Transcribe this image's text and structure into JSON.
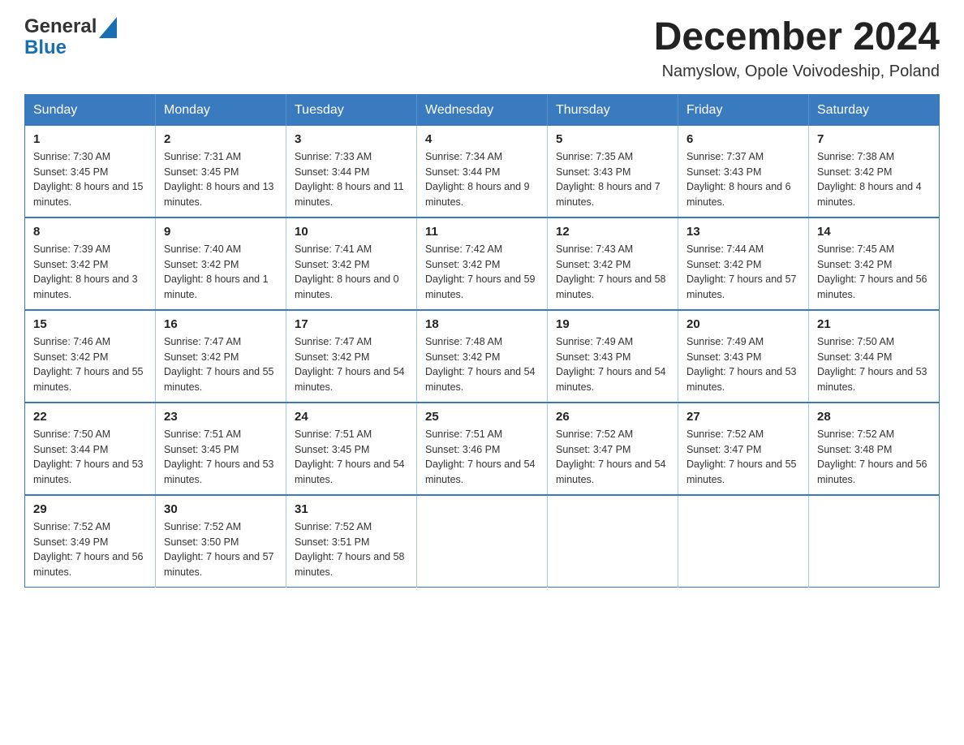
{
  "header": {
    "logo_general": "General",
    "logo_blue": "Blue",
    "month_year": "December 2024",
    "location": "Namyslow, Opole Voivodeship, Poland"
  },
  "days_of_week": [
    "Sunday",
    "Monday",
    "Tuesday",
    "Wednesday",
    "Thursday",
    "Friday",
    "Saturday"
  ],
  "weeks": [
    [
      {
        "day": "1",
        "sunrise": "7:30 AM",
        "sunset": "3:45 PM",
        "daylight": "8 hours and 15 minutes."
      },
      {
        "day": "2",
        "sunrise": "7:31 AM",
        "sunset": "3:45 PM",
        "daylight": "8 hours and 13 minutes."
      },
      {
        "day": "3",
        "sunrise": "7:33 AM",
        "sunset": "3:44 PM",
        "daylight": "8 hours and 11 minutes."
      },
      {
        "day": "4",
        "sunrise": "7:34 AM",
        "sunset": "3:44 PM",
        "daylight": "8 hours and 9 minutes."
      },
      {
        "day": "5",
        "sunrise": "7:35 AM",
        "sunset": "3:43 PM",
        "daylight": "8 hours and 7 minutes."
      },
      {
        "day": "6",
        "sunrise": "7:37 AM",
        "sunset": "3:43 PM",
        "daylight": "8 hours and 6 minutes."
      },
      {
        "day": "7",
        "sunrise": "7:38 AM",
        "sunset": "3:42 PM",
        "daylight": "8 hours and 4 minutes."
      }
    ],
    [
      {
        "day": "8",
        "sunrise": "7:39 AM",
        "sunset": "3:42 PM",
        "daylight": "8 hours and 3 minutes."
      },
      {
        "day": "9",
        "sunrise": "7:40 AM",
        "sunset": "3:42 PM",
        "daylight": "8 hours and 1 minute."
      },
      {
        "day": "10",
        "sunrise": "7:41 AM",
        "sunset": "3:42 PM",
        "daylight": "8 hours and 0 minutes."
      },
      {
        "day": "11",
        "sunrise": "7:42 AM",
        "sunset": "3:42 PM",
        "daylight": "7 hours and 59 minutes."
      },
      {
        "day": "12",
        "sunrise": "7:43 AM",
        "sunset": "3:42 PM",
        "daylight": "7 hours and 58 minutes."
      },
      {
        "day": "13",
        "sunrise": "7:44 AM",
        "sunset": "3:42 PM",
        "daylight": "7 hours and 57 minutes."
      },
      {
        "day": "14",
        "sunrise": "7:45 AM",
        "sunset": "3:42 PM",
        "daylight": "7 hours and 56 minutes."
      }
    ],
    [
      {
        "day": "15",
        "sunrise": "7:46 AM",
        "sunset": "3:42 PM",
        "daylight": "7 hours and 55 minutes."
      },
      {
        "day": "16",
        "sunrise": "7:47 AM",
        "sunset": "3:42 PM",
        "daylight": "7 hours and 55 minutes."
      },
      {
        "day": "17",
        "sunrise": "7:47 AM",
        "sunset": "3:42 PM",
        "daylight": "7 hours and 54 minutes."
      },
      {
        "day": "18",
        "sunrise": "7:48 AM",
        "sunset": "3:42 PM",
        "daylight": "7 hours and 54 minutes."
      },
      {
        "day": "19",
        "sunrise": "7:49 AM",
        "sunset": "3:43 PM",
        "daylight": "7 hours and 54 minutes."
      },
      {
        "day": "20",
        "sunrise": "7:49 AM",
        "sunset": "3:43 PM",
        "daylight": "7 hours and 53 minutes."
      },
      {
        "day": "21",
        "sunrise": "7:50 AM",
        "sunset": "3:44 PM",
        "daylight": "7 hours and 53 minutes."
      }
    ],
    [
      {
        "day": "22",
        "sunrise": "7:50 AM",
        "sunset": "3:44 PM",
        "daylight": "7 hours and 53 minutes."
      },
      {
        "day": "23",
        "sunrise": "7:51 AM",
        "sunset": "3:45 PM",
        "daylight": "7 hours and 53 minutes."
      },
      {
        "day": "24",
        "sunrise": "7:51 AM",
        "sunset": "3:45 PM",
        "daylight": "7 hours and 54 minutes."
      },
      {
        "day": "25",
        "sunrise": "7:51 AM",
        "sunset": "3:46 PM",
        "daylight": "7 hours and 54 minutes."
      },
      {
        "day": "26",
        "sunrise": "7:52 AM",
        "sunset": "3:47 PM",
        "daylight": "7 hours and 54 minutes."
      },
      {
        "day": "27",
        "sunrise": "7:52 AM",
        "sunset": "3:47 PM",
        "daylight": "7 hours and 55 minutes."
      },
      {
        "day": "28",
        "sunrise": "7:52 AM",
        "sunset": "3:48 PM",
        "daylight": "7 hours and 56 minutes."
      }
    ],
    [
      {
        "day": "29",
        "sunrise": "7:52 AM",
        "sunset": "3:49 PM",
        "daylight": "7 hours and 56 minutes."
      },
      {
        "day": "30",
        "sunrise": "7:52 AM",
        "sunset": "3:50 PM",
        "daylight": "7 hours and 57 minutes."
      },
      {
        "day": "31",
        "sunrise": "7:52 AM",
        "sunset": "3:51 PM",
        "daylight": "7 hours and 58 minutes."
      },
      null,
      null,
      null,
      null
    ]
  ],
  "labels": {
    "sunrise": "Sunrise:",
    "sunset": "Sunset:",
    "daylight": "Daylight:"
  }
}
